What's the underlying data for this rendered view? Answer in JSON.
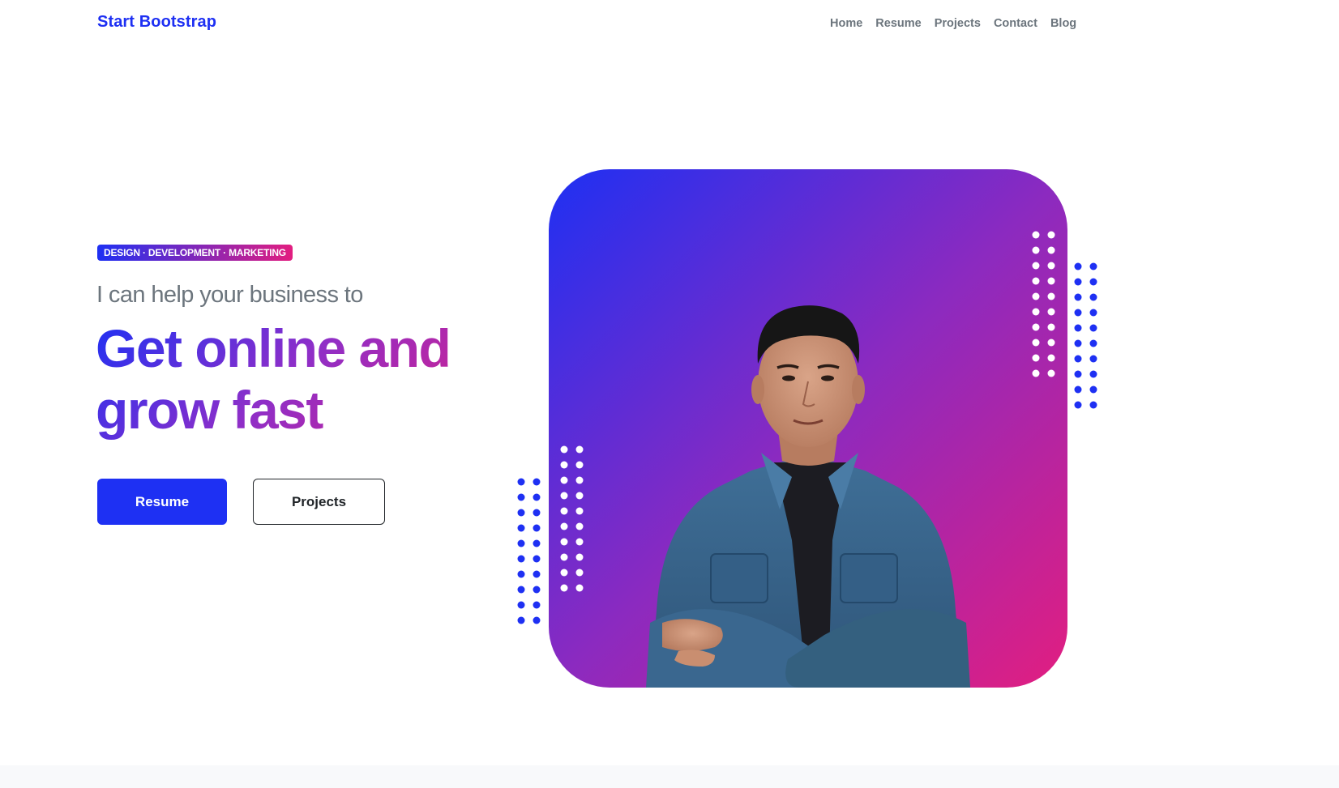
{
  "navbar": {
    "brand": "Start Bootstrap",
    "links": [
      "Home",
      "Resume",
      "Projects",
      "Contact",
      "Blog"
    ]
  },
  "hero": {
    "badge": "DESIGN · DEVELOPMENT · MARKETING",
    "lead": "I can help your business to",
    "headline_line1": "Get online and",
    "headline_line2": "grow fast",
    "primary_button": "Resume",
    "secondary_button": "Projects"
  },
  "colors": {
    "brand_primary": "#1e30f3",
    "brand_secondary": "#e21e80",
    "nav_text": "#6c757d",
    "dark_text": "#212529"
  },
  "icons": {
    "profile": "person-portrait",
    "decor": "dot-grid-pattern"
  }
}
